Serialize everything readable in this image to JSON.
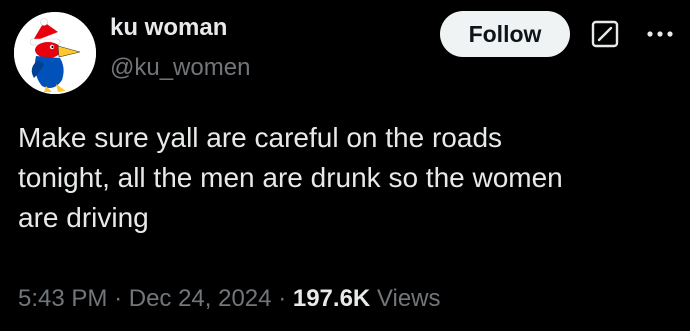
{
  "author": {
    "name": "ku woman",
    "handle": "@ku_women"
  },
  "actions": {
    "follow_label": "Follow",
    "grok_icon": "grok-icon",
    "more_icon": "more-icon"
  },
  "tweet": {
    "text": "Make sure yall are careful on the roads\ntonight, all the men are drunk so the women\nare driving"
  },
  "meta": {
    "time": "5:43 PM",
    "separator": "·",
    "date": "Dec 24, 2024",
    "views_count": "197.6K",
    "views_label": "Views"
  },
  "colors": {
    "background": "#000000",
    "primary_text": "#e7e9ea",
    "secondary_text": "#71767b",
    "follow_bg": "#eff3f4",
    "follow_text": "#0f1419",
    "jayhawk_blue": "#0051ba",
    "jayhawk_red": "#e8000d",
    "beak_yellow": "#ffc82d"
  }
}
